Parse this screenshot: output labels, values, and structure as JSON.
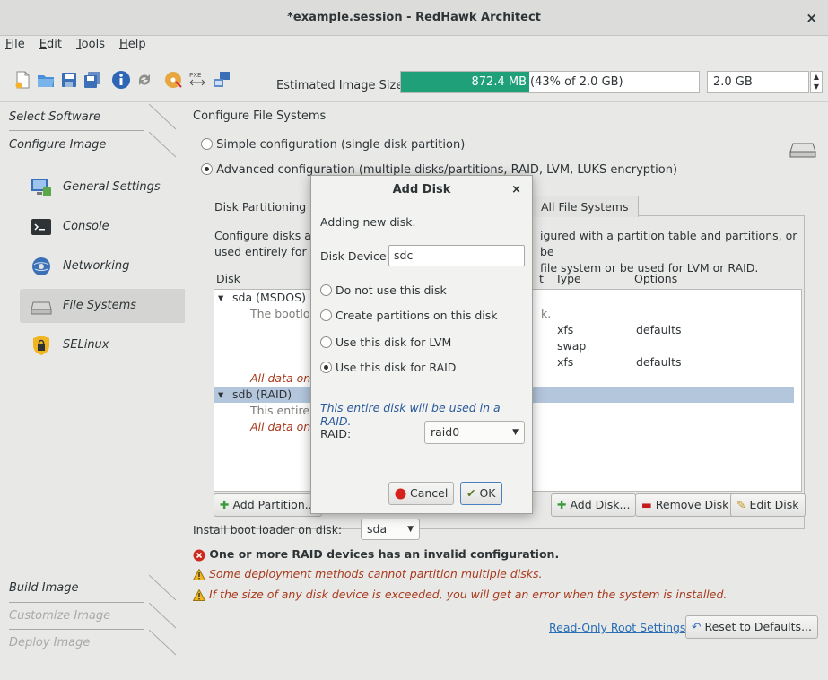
{
  "window": {
    "title": "*example.session - RedHawk Architect",
    "close": "×"
  },
  "menu": [
    {
      "label": "File",
      "key": "F"
    },
    {
      "label": "Edit",
      "key": "E"
    },
    {
      "label": "Tools",
      "key": "T"
    },
    {
      "label": "Help",
      "key": "H"
    }
  ],
  "toolbar": {
    "est_label": "Estimated Image Size:",
    "progress_value": "872.4 MB",
    "progress_pct_text": "(43% of 2.0 GB)",
    "progress_fraction": 0.43,
    "size_value": "2.0 GB",
    "pxe_text": "PXE"
  },
  "sidebar": {
    "select_software": "Select Software",
    "configure_image": "Configure Image",
    "items": [
      {
        "label": "General Settings",
        "icon": "general-settings-icon"
      },
      {
        "label": "Console",
        "icon": "console-icon"
      },
      {
        "label": "Networking",
        "icon": "networking-icon"
      },
      {
        "label": "File Systems",
        "icon": "hard-disk-icon"
      },
      {
        "label": "SELinux",
        "icon": "lock-icon"
      }
    ],
    "build_image": "Build Image",
    "customize_image": "Customize Image",
    "deploy_image": "Deploy Image"
  },
  "main": {
    "title": "Configure File Systems",
    "simple_option": "Simple configuration (single disk partition)",
    "advanced_option": "Advanced configuration (multiple disks/partitions, RAID, LVM, LUKS encryption)",
    "tabs": [
      "Disk Partitioning",
      "All File Systems"
    ],
    "description_left_1": "Configure disks an",
    "description_left_2": "used entirely for L",
    "description_right_1": "igured with a partition table and partitions, or be",
    "description_right_2": "file system or be used for LVM or RAID.",
    "columns": {
      "disk": "Disk",
      "t": "t",
      "type": "Type",
      "options": "Options"
    },
    "tree": {
      "sda": "sda (MSDOS)",
      "sda_boot_left": "The bootlo",
      "sda_boot_right": "k.",
      "rows": [
        {
          "type": "xfs",
          "options": "defaults"
        },
        {
          "type": "swap",
          "options": ""
        },
        {
          "type": "xfs",
          "options": "defaults"
        }
      ],
      "sda_all_data": "All data on t",
      "sdb": "sdb (RAID)",
      "sdb_entire": "This entire",
      "sdb_all_data": "All data on t"
    },
    "buttons": {
      "add_partition": "Add Partition...",
      "add_disk": "Add Disk...",
      "remove_disk": "Remove Disk",
      "edit_disk": "Edit Disk"
    },
    "bootloader_label": "Install boot loader on disk:",
    "bootloader_value": "sda",
    "error_msg": "One or more RAID devices has an invalid configuration.",
    "warn_msg_1": "Some deployment methods cannot partition multiple disks.",
    "warn_msg_2": "If the size of any disk device is exceeded, you will get an error when the system is installed.",
    "readonly_link": "Read-Only Root Settings",
    "reset_button": "Reset to Defaults..."
  },
  "dialog": {
    "title": "Add Disk",
    "close": "×",
    "intro": "Adding new disk.",
    "device_label": "Disk Device:",
    "device_value": "sdc",
    "options": [
      {
        "label": "Do not use this disk",
        "selected": false
      },
      {
        "label": "Create partitions on this disk",
        "selected": false
      },
      {
        "label": "Use this disk for LVM",
        "selected": false
      },
      {
        "label": "Use this disk for RAID",
        "selected": true
      }
    ],
    "raid_note": "This entire disk will be used in a RAID.",
    "raid_label": "RAID:",
    "raid_value": "raid0",
    "cancel": "Cancel",
    "ok": "OK"
  },
  "colors": {
    "progress": "#1fa078",
    "selection": "#b4c6dc",
    "link": "#2a6db3",
    "warning": "#a83a1c"
  }
}
